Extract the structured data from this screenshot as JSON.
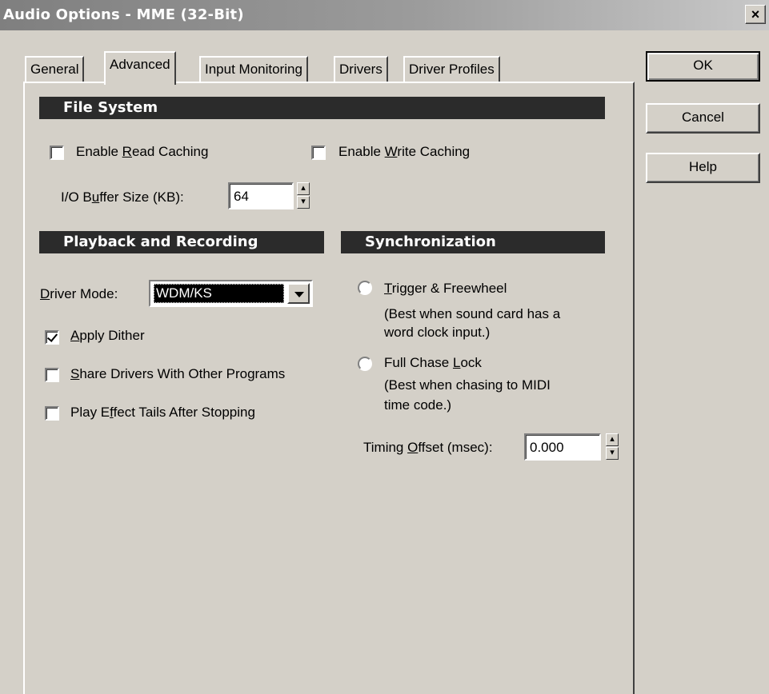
{
  "window": {
    "title": "Audio Options - MME (32-Bit)",
    "close_label": "×"
  },
  "tabs": [
    "General",
    "Advanced",
    "Input Monitoring",
    "Drivers",
    "Driver Profiles"
  ],
  "active_tab": "Advanced",
  "buttons": {
    "ok": "OK",
    "cancel": "Cancel",
    "help": "Help"
  },
  "file_system": {
    "header": "File System",
    "read_caching": {
      "pre": "Enable ",
      "u": "R",
      "post": "ead Caching",
      "checked": false
    },
    "write_caching": {
      "pre": "Enable ",
      "u": "W",
      "post": "rite Caching",
      "checked": false
    },
    "buffer": {
      "pre": "I/O B",
      "u": "u",
      "post": "ffer Size (KB):",
      "value": "64"
    }
  },
  "playback": {
    "header": "Playback and Recording",
    "driver_mode": {
      "u": "D",
      "post": "river Mode:",
      "value": "WDM/KS"
    },
    "apply_dither": {
      "u": "A",
      "post": "pply Dither",
      "checked": true
    },
    "share_drivers": {
      "u": "S",
      "post": "hare Drivers With Other Programs",
      "checked": false
    },
    "effect_tails": {
      "pre": "Play E",
      "u": "f",
      "post": "fect Tails After Stopping",
      "checked": false
    }
  },
  "sync": {
    "header": "Synchronization",
    "trigger": {
      "u": "T",
      "post": "rigger & Freewheel",
      "desc1": "(Best when sound card has a",
      "desc2": "word clock input.)"
    },
    "chase": {
      "pre": "Full Chase ",
      "u": "L",
      "post": "ock",
      "desc1": "(Best when chasing to MIDI",
      "desc2": "time code.)"
    },
    "offset": {
      "pre": "Timing ",
      "u": "O",
      "post": "ffset (msec):",
      "value": "0.000"
    }
  }
}
